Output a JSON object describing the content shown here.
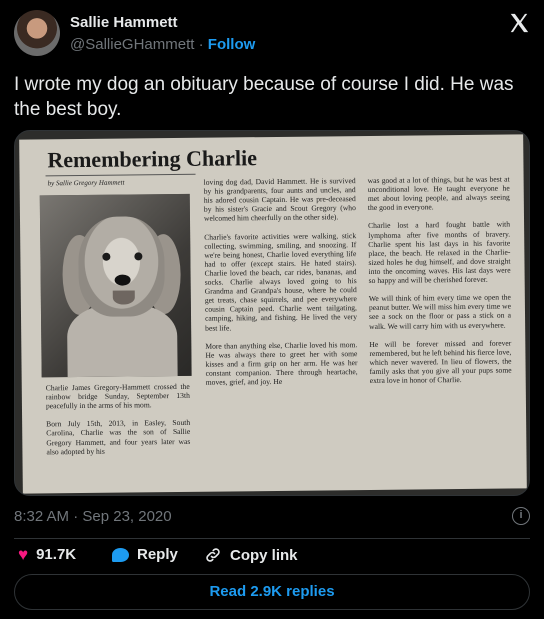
{
  "author": {
    "name": "Sallie Hammett",
    "handle": "@SallieGHammett",
    "separator": "·",
    "follow_label": "Follow"
  },
  "tweet": {
    "text": "I wrote my dog an obituary because of course I did. He was the best boy.",
    "timestamp": "8:32 AM · Sep 23, 2020"
  },
  "newspaper": {
    "title": "Remembering Charlie",
    "byline": "by Sallie Gregory Hammett",
    "col1": "Charlie James Gregory-Hammett crossed the rainbow bridge Sunday, September 13th peacefully in the arms of his mom.\n\nBorn July 15th, 2013, in Easley, South Carolina, Charlie was the son of Sallie Gregory Hammett, and four years later was also adopted by his",
    "col2": "loving dog dad, David Hammett. He is survived by his grandparents, four aunts and uncles, and his adored cousin Captain. He was pre-deceased by his sister's Gracie and Scout Gregory (who welcomed him cheerfully on the other side).\n\nCharlie's favorite activities were walking, stick collecting, swimming, smiling, and snoozing. If we're being honest, Charlie loved everything life had to offer (except stairs. He hated stairs). Charlie loved the beach, car rides, bananas, and socks. Charlie always loved going to his Grandma and Grandpa's house, where he could get treats, chase squirrels, and pee everywhere cousin Captain peed. Charlie went tailgating, camping, hiking, and fishing. He lived the very best life.\n\nMore than anything else, Charlie loved his mom. He was always there to greet her with some kisses and a firm grip on her arm. He was her constant companion. There through heartache, moves, grief, and joy. He",
    "col3": "was good at a lot of things, but he was best at unconditional love. He taught everyone he met about loving people, and always seeing the good in everyone.\n\nCharlie lost a hard fought battle with lymphoma after five months of bravery. Charlie spent his last days in his favorite place, the beach. He relaxed in the Charlie-sized holes he dug himself, and dove straight into the oncoming waves. His last days were so happy and will be cherished forever.\n\nWe will think of him every time we open the peanut butter. We will miss him every time we see a sock on the floor or pass a stick on a walk. We will carry him with us everywhere.\n\nHe will be forever missed and forever remembered, but he left behind his fierce love, which never wavered. In lieu of flowers, the family asks that you give all your pups some extra love in honor of Charlie."
  },
  "actions": {
    "likes": "91.7K",
    "reply_label": "Reply",
    "copy_link_label": "Copy link",
    "read_replies_label": "Read 2.9K replies"
  },
  "icons": {
    "like": "heart-icon",
    "reply": "reply-bubble-icon",
    "copy": "link-icon",
    "info": "info-icon",
    "logo": "x-logo-icon"
  },
  "colors": {
    "background": "#000000",
    "text": "#e7e9ea",
    "muted": "#71767b",
    "accent": "#1d9bf0",
    "like": "#f91880",
    "border": "#2f3336"
  }
}
